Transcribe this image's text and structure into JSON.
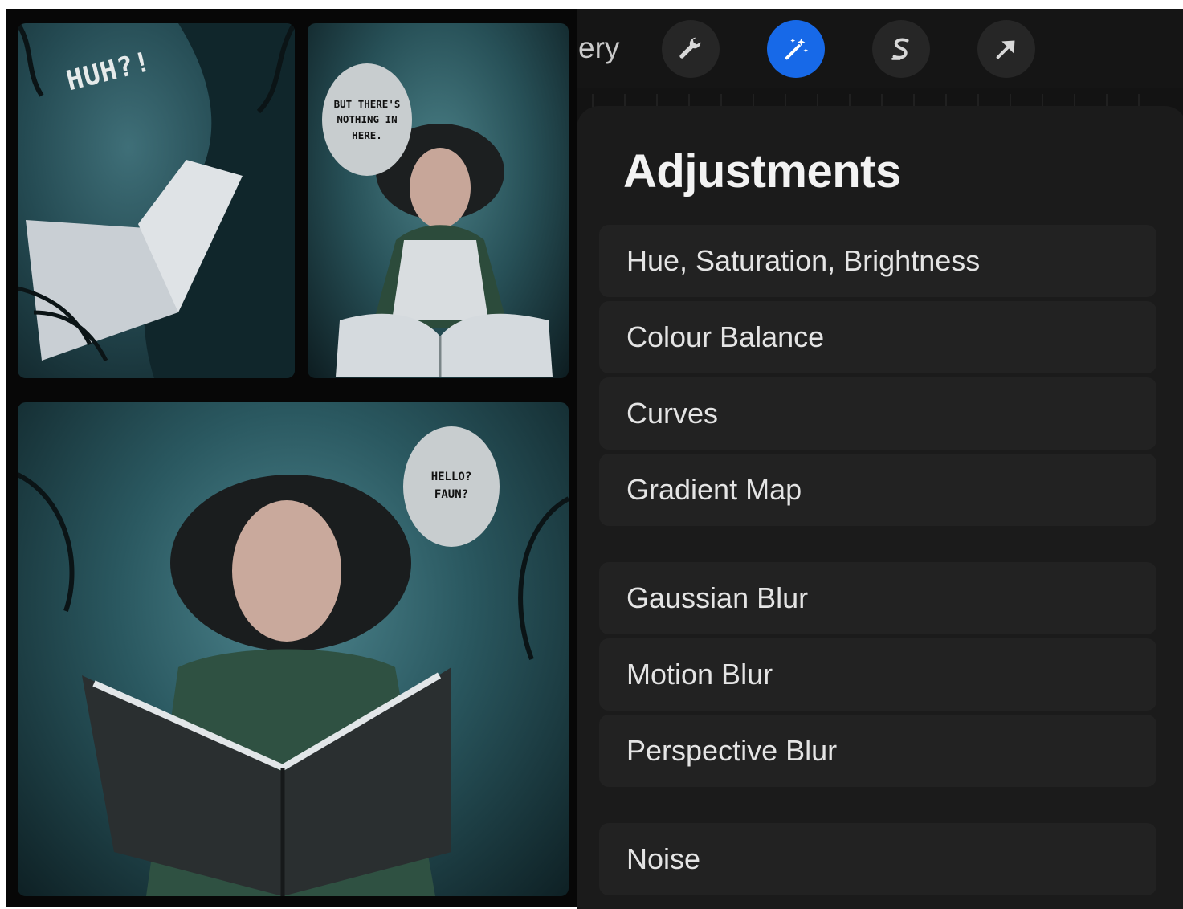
{
  "toolbar": {
    "gallery_label_visible": "ery",
    "tools": [
      {
        "name": "actions",
        "icon": "wrench-icon",
        "active": false
      },
      {
        "name": "adjustments",
        "icon": "magic-wand-icon",
        "active": true
      },
      {
        "name": "selection",
        "icon": "selection-s-icon",
        "active": false
      },
      {
        "name": "transform",
        "icon": "arrow-cursor-icon",
        "active": false
      }
    ],
    "active_color": "#1769e8"
  },
  "adjustments": {
    "title": "Adjustments",
    "items": [
      "Hue, Saturation, Brightness",
      "Colour Balance",
      "Curves",
      "Gradient Map",
      "Gaussian Blur",
      "Motion Blur",
      "Perspective Blur",
      "Noise"
    ]
  },
  "canvas": {
    "sfx": "HUH?!",
    "balloons": [
      "BUT THERE'S NOTHING IN HERE.",
      "HELLO? FAUN?"
    ]
  }
}
